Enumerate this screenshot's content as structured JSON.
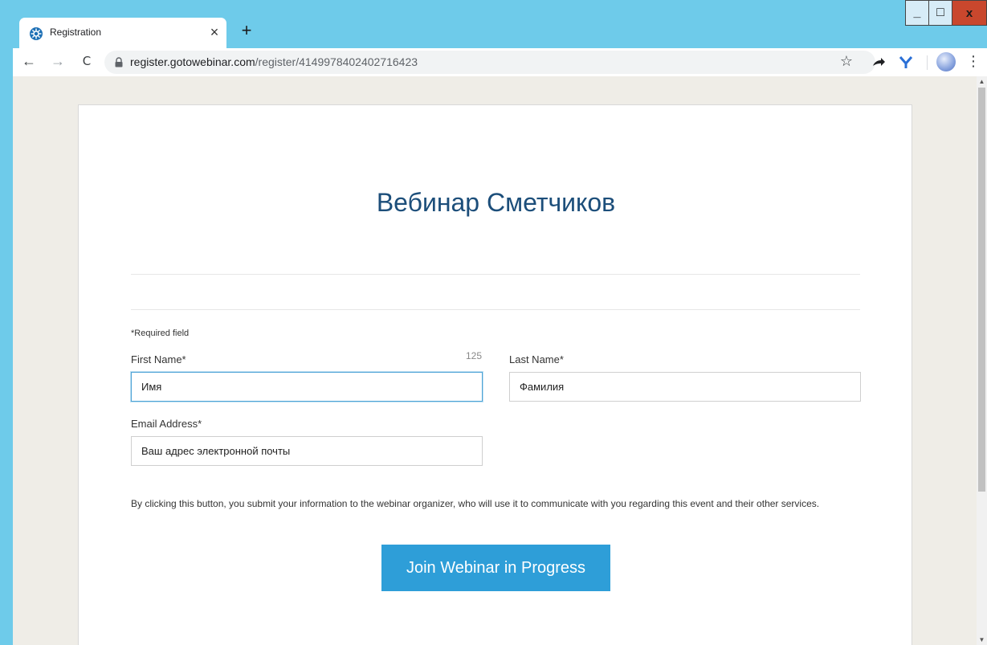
{
  "browser": {
    "tab": {
      "title": "Registration",
      "close_glyph": "×"
    },
    "new_tab_glyph": "+",
    "window": {
      "minimize_glyph": "_",
      "maximize_glyph": "□",
      "close_glyph": "x"
    },
    "nav": {
      "back": "←",
      "forward": "→",
      "reload": "C"
    },
    "url": {
      "host": "register.gotowebinar.com",
      "path": "/register/4149978402402716423"
    },
    "star_glyph": "☆",
    "menu_glyph": "⋮",
    "icons": {
      "favicon": "gotowebinar-favicon-icon",
      "lock": "lock-icon",
      "share": "share-arrow-icon",
      "extension": "extension-y-icon",
      "profile": "profile-avatar"
    }
  },
  "page": {
    "title": "Вебинар Сметчиков",
    "required_note": "*Required field",
    "form": {
      "first_name": {
        "label": "First Name*",
        "value": "Имя",
        "char_count": "125"
      },
      "last_name": {
        "label": "Last Name*",
        "value": "Фамилия"
      },
      "email": {
        "label": "Email Address*",
        "value": "Ваш адрес электронной почты"
      }
    },
    "disclaimer": "By clicking this button, you submit your information to the webinar organizer, who will use it to communicate with you regarding this event and their other services.",
    "submit_label": "Join Webinar in Progress"
  },
  "colors": {
    "frame": "#6ecbea",
    "title": "#1c4e7a",
    "button": "#2e9ed8",
    "page_bg": "#efede7"
  }
}
